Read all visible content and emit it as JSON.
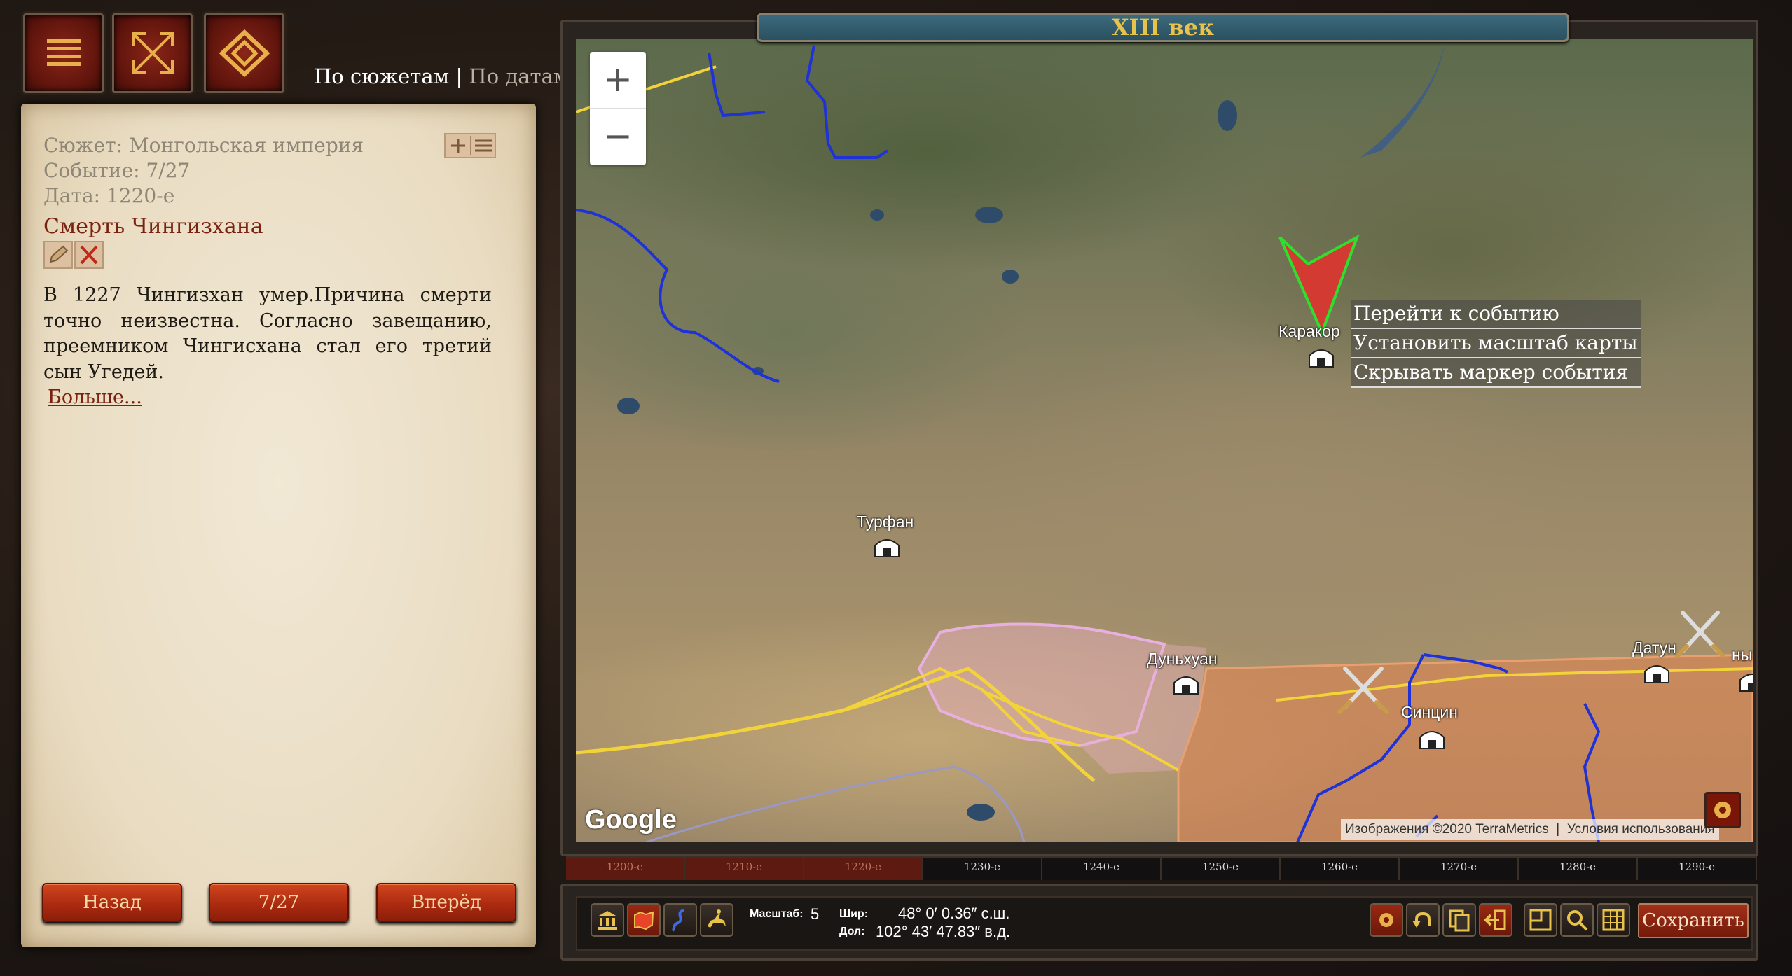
{
  "toolbar": {
    "menu_icon": "hamburger-icon",
    "fullscreen_icon": "expand-arrows-icon",
    "emblem_icon": "diamond-eye-icon"
  },
  "mode_switch": {
    "active": "По сюжетам",
    "separator": "|",
    "inactive": "По датам"
  },
  "event_panel": {
    "plot": "Сюжет: Монгольская империя",
    "event_index": "Событие: 7/27",
    "date": "Дата: 1220-е",
    "title": "Смерть Чингизхана",
    "description": "В 1227 Чингизхан умер.Причина смерти точно неизвестна. Согласно завещанию, преемником Чингисхана стал его третий сын Угедей.",
    "more_link": "Больше...",
    "back": "Назад",
    "counter": "7/27",
    "forward": "Вперёд"
  },
  "map": {
    "century": "XIII век",
    "zoom_in": "+",
    "zoom_out": "−",
    "context_menu": [
      "Перейти к событию",
      "Установить масштаб карты",
      "Скрывать маркер события"
    ],
    "cities": {
      "karakorum": "Каракор",
      "turfan": "Турфан",
      "dunhuang": "Дуньхуан",
      "xining": "Синцин",
      "datong": "Датун",
      "partial": "ны"
    },
    "google_logo": "Google",
    "attribution_imagery": "Изображения ©2020 TerraMetrics",
    "attribution_terms": "Условия использования"
  },
  "timeline": {
    "decades": [
      "1200-е",
      "1210-е",
      "1220-е",
      "1230-е",
      "1240-е",
      "1250-е",
      "1260-е",
      "1270-е",
      "1280-е",
      "1290-е"
    ],
    "past_count": 3
  },
  "status": {
    "scale_label": "Масштаб:",
    "scale_value": "5",
    "lat_label": "Шир:",
    "lat_value": "48° 0′ 0.36″ с.ш.",
    "lon_label": "Дол:",
    "lon_value": "102° 43′ 47.83″ в.д.",
    "save": "Сохранить"
  },
  "colors": {
    "accent_red": "#9a2812",
    "century_gold": "#e8c24a",
    "border_blue": "#1e32d8",
    "border_yellow": "#f2d33a",
    "event_marker": "#d23a32",
    "event_marker_outline": "#2ee02e"
  }
}
